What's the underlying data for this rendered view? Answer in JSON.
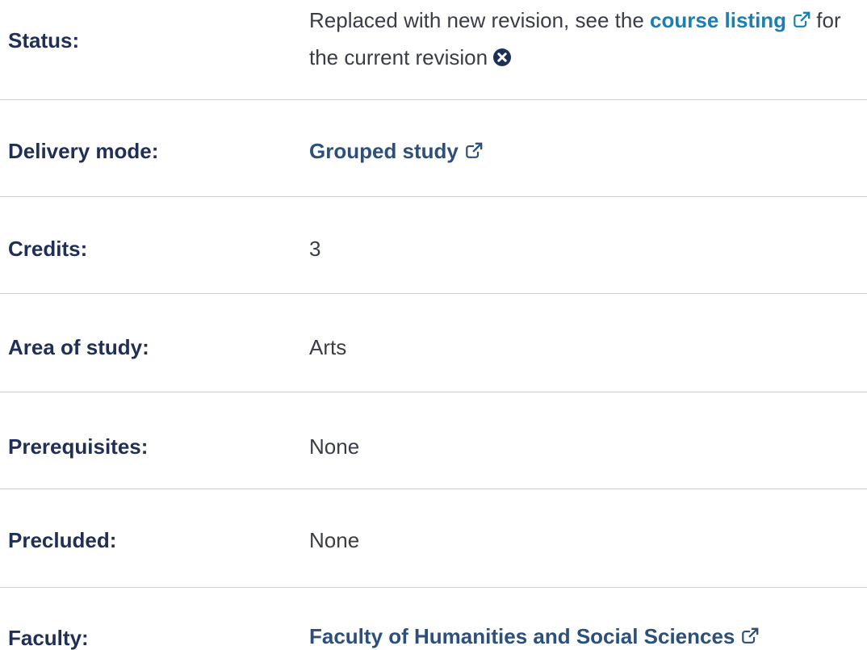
{
  "rows": {
    "status": {
      "label": "Status:",
      "text_before": "Replaced with new revision, see the ",
      "link_text_line1": "course",
      "link_text_line2": "listing",
      "text_after": " for the current revision"
    },
    "delivery_mode": {
      "label": "Delivery mode:",
      "value": "Grouped study"
    },
    "credits": {
      "label": "Credits:",
      "value": "3"
    },
    "area_of_study": {
      "label": "Area of study:",
      "value": "Arts"
    },
    "prerequisites": {
      "label": "Prerequisites:",
      "value": "None"
    },
    "precluded": {
      "label": "Precluded:",
      "value": "None"
    },
    "faculty": {
      "label": "Faculty:",
      "value": "Faculty of Humanities and Social Sciences"
    }
  },
  "icons": {
    "external_link": "external-link-icon",
    "close": "close-circle-icon"
  },
  "colors": {
    "label": "#1f2f55",
    "value": "#3a3d48",
    "link": "#2d4f7c",
    "inline_link": "#1a7fb3",
    "divider": "#cfd3d8"
  }
}
